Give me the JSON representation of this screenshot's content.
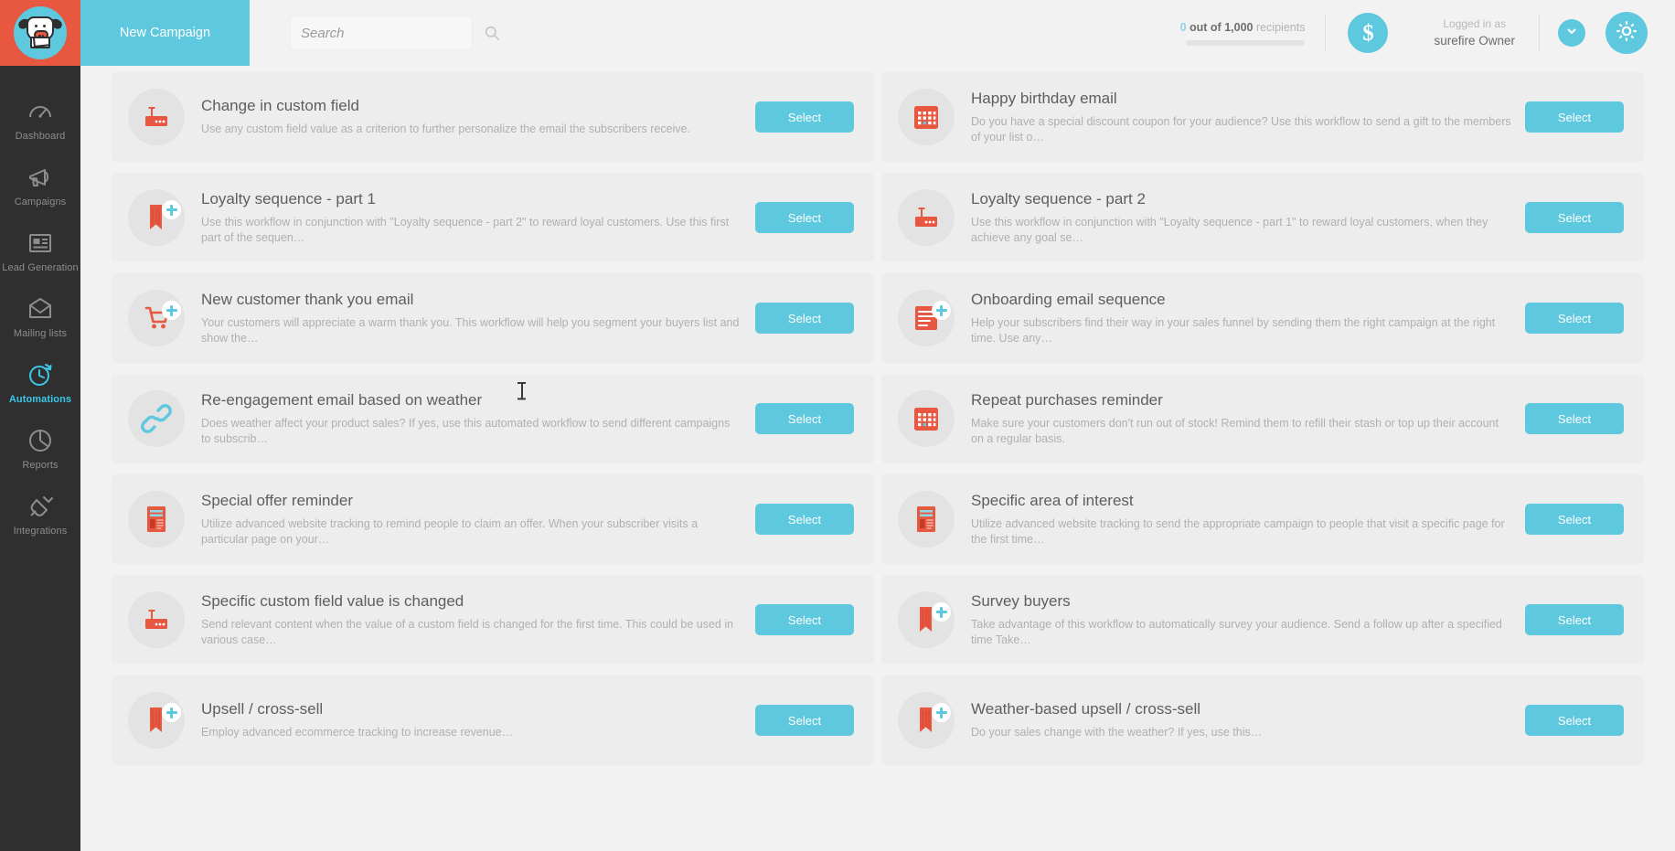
{
  "app": {
    "logo_name": "moosend-cow-logo",
    "accent": "#5ec8de",
    "accent_red": "#e8573f",
    "sidebar_bg": "#2f2f2f",
    "card_bg": "#ededed"
  },
  "topbar": {
    "new_campaign_label": "New Campaign",
    "search_placeholder": "Search",
    "search_value": "",
    "search_icon": "search-icon",
    "recipients": {
      "count": "0",
      "middle": "out of 1,000",
      "suffix": "recipients",
      "full_text": "0 out of 1,000 recipients",
      "progress_percent": 0
    },
    "credits_icon": "dollar-icon",
    "logged_in_label": "Logged in as",
    "account_name": "surefire Owner",
    "chevron_icon": "chevron-down-icon",
    "gear_icon": "gear-icon"
  },
  "sidebar": {
    "items": [
      {
        "label": "Dashboard",
        "icon": "gauge-icon",
        "active": false
      },
      {
        "label": "Campaigns",
        "icon": "megaphone-icon",
        "active": false
      },
      {
        "label": "Lead Generation",
        "icon": "form-icon",
        "active": false
      },
      {
        "label": "Mailing lists",
        "icon": "envelope-icon",
        "active": false
      },
      {
        "label": "Automations",
        "icon": "clock-icon",
        "active": true
      },
      {
        "label": "Reports",
        "icon": "pie-chart-icon",
        "active": false
      },
      {
        "label": "Integrations",
        "icon": "plug-icon",
        "active": false
      }
    ]
  },
  "main": {
    "select_label": "Select",
    "recipes": [
      {
        "title": "Change in custom field",
        "description": "Use any custom field value as a criterion to further personalize the email the subscribers receive.",
        "icon": "custom-field-icon",
        "plus": false,
        "select": "Select"
      },
      {
        "title": "Happy birthday email",
        "description": "Do you have a special discount coupon for your audience? Use this workflow to send a gift to the members of your list o…",
        "icon": "calendar-icon",
        "plus": false,
        "select": "Select"
      },
      {
        "title": "Loyalty sequence - part 1",
        "description": "Use this workflow in conjunction with \"Loyalty sequence - part 2\" to reward loyal customers. Use this first part of the sequen…",
        "icon": "bookmark-icon",
        "plus": true,
        "select": "Select"
      },
      {
        "title": "Loyalty sequence - part 2",
        "description": "Use this workflow in conjunction with \"Loyalty sequence - part 1\" to reward loyal customers, when they achieve any goal se…",
        "icon": "custom-field-icon",
        "plus": false,
        "select": "Select"
      },
      {
        "title": "New customer thank you email",
        "description": "Your customers will appreciate a warm thank you. This workflow will help you segment your buyers list and show the…",
        "icon": "cart-icon",
        "plus": true,
        "select": "Select"
      },
      {
        "title": "Onboarding email sequence",
        "description": "Help your subscribers find their way in your sales funnel by sending them the right campaign at the right time. Use any…",
        "icon": "list-icon",
        "plus": true,
        "select": "Select"
      },
      {
        "title": "Re-engagement email based on weather",
        "description": "Does weather affect your product sales? If yes, use this automated workflow to send different campaigns to subscrib…",
        "icon": "link-icon",
        "plus": false,
        "select": "Select"
      },
      {
        "title": "Repeat purchases reminder",
        "description": "Make sure your customers don't run out of stock! Remind them to refill their stash or top up their account on a regular basis.",
        "icon": "calendar-icon",
        "plus": false,
        "select": "Select"
      },
      {
        "title": "Special offer reminder",
        "description": "Utilize advanced website tracking to remind people to claim an offer. When your subscriber visits a particular page on your…",
        "icon": "page-icon",
        "plus": false,
        "select": "Select"
      },
      {
        "title": "Specific area of interest",
        "description": "Utilize advanced website tracking to send the appropriate campaign to people that visit a specific page for the first time…",
        "icon": "page-icon",
        "plus": false,
        "select": "Select"
      },
      {
        "title": "Specific custom field value is changed",
        "description": "Send relevant content when the value of a custom field is changed for the first time. This could be used in various case…",
        "icon": "custom-field-icon",
        "plus": false,
        "select": "Select"
      },
      {
        "title": "Survey buyers",
        "description": "Take advantage of this workflow to automatically survey your audience. Send a follow up after a specified time Take…",
        "icon": "bookmark-icon",
        "plus": true,
        "select": "Select"
      },
      {
        "title": "Upsell / cross-sell",
        "description": "Employ advanced ecommerce tracking to increase revenue…",
        "icon": "bookmark-icon",
        "plus": true,
        "select": "Select"
      },
      {
        "title": "Weather-based upsell / cross-sell",
        "description": "Do your sales change with the weather? If yes, use this…",
        "icon": "bookmark-icon",
        "plus": true,
        "select": "Select"
      }
    ]
  }
}
